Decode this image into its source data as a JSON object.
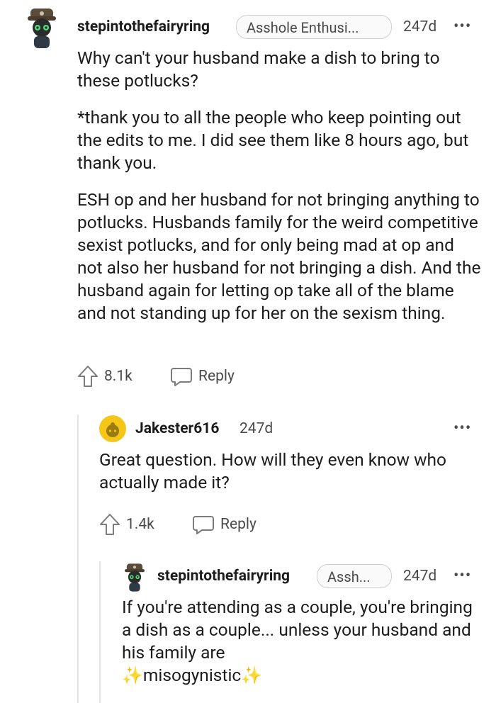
{
  "comments": [
    {
      "username": "stepintothefairyring",
      "flair": "Asshole Enthusi...",
      "age": "247d",
      "paragraphs": [
        "Why can't your husband make a dish to bring to these potlucks?",
        "*thank you to all the people who keep pointing out the edits to me. I did see them like 8 hours ago, but thank you.",
        "ESH op and her husband for not bringing anything to potlucks. Husbands family for the weird competitive sexist potlucks, and for only being mad at op and not also her husband for not bringing a dish. And the husband again for letting op take all of the blame and not standing up for her on the sexism thing."
      ],
      "upvotes": "8.1k",
      "reply_label": "Reply"
    },
    {
      "username": "Jakester616",
      "age": "247d",
      "paragraphs": [
        "Great question. How will they even know who actually made it?"
      ],
      "upvotes": "1.4k",
      "reply_label": "Reply"
    },
    {
      "username": "stepintothefairyring",
      "flair": "Assh...",
      "age": "247d",
      "text_before": "If you're attending as a couple, you're bringing a dish as a couple... unless your husband and his family are",
      "sparkle": "✨",
      "emphasis": "misogynistic"
    }
  ],
  "more_icon": "•••",
  "icons": {
    "upvote": "upvote-arrow-icon",
    "reply": "speech-bubble-icon",
    "more": "more-options-icon"
  },
  "colors": {
    "text": "#1c1c1c",
    "muted": "#4a4a4a",
    "thread_line": "#e4e4e4",
    "avatar_snoo": "#f5c518"
  }
}
